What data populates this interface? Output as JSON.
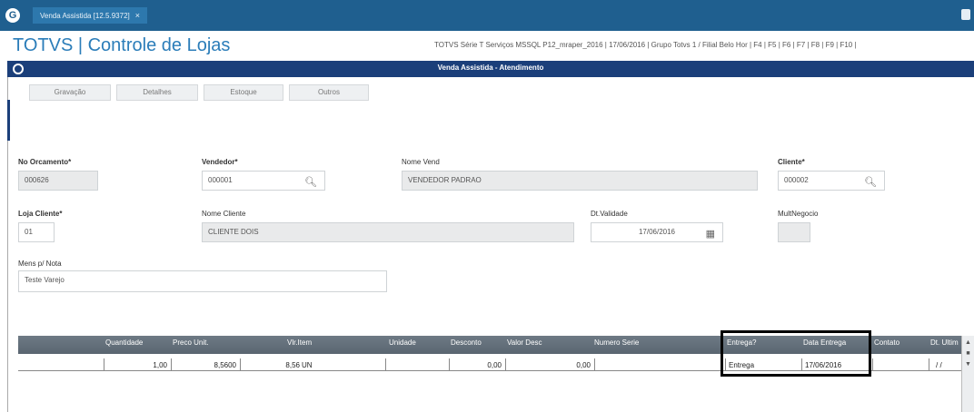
{
  "titlebar": {
    "tab_label": "Venda Assistida [12.5.9372]",
    "tab_close": "×"
  },
  "header": {
    "app_title": "TOTVS | Controle de Lojas",
    "info": "TOTVS Série T Serviços MSSQL P12_mraper_2016  |  17/06/2016  |  Grupo Totvs 1 / Filial Belo Hor  |  F4 | F5 | F6 | F7 | F8 | F9 | F10 |"
  },
  "window": {
    "title": "Venda Assistida - Atendimento"
  },
  "toolbar": {
    "gravacao": "Gravação",
    "detalhes": "Detalhes",
    "estoque": "Estoque",
    "outros": "Outros"
  },
  "form": {
    "num_orcamento": {
      "label": "No Orcamento*",
      "value": "000626"
    },
    "vendedor": {
      "label": "Vendedor*",
      "value": "000001"
    },
    "nome_vend": {
      "label": "Nome Vend",
      "value": "VENDEDOR PADRAO"
    },
    "cliente": {
      "label": "Cliente*",
      "value": "000002"
    },
    "loja_cliente": {
      "label": "Loja Cliente*",
      "value": "01"
    },
    "nome_cliente": {
      "label": "Nome Cliente",
      "value": "CLIENTE DOIS"
    },
    "dt_validade": {
      "label": "Dt.Validade",
      "value": "17/06/2016"
    },
    "multinegocio": {
      "label": "MultNegocio",
      "value": ""
    },
    "mens_nota": {
      "label": "Mens p/ Nota",
      "value": "Teste Varejo"
    }
  },
  "grid": {
    "headers": {
      "quantidade": "Quantidade",
      "preco_unit": "Preco Unit.",
      "vlr_item": "Vlr.Item",
      "unidade": "Unidade",
      "desconto": "Desconto",
      "valor_desc": "Valor Desc",
      "numero_serie": "Numero Serie",
      "entrega": "Entrega?",
      "data_entrega": "Data Entrega",
      "contato": "Contato",
      "dt_ultima": "Dt. Ultim"
    },
    "row": {
      "quantidade": "1,00",
      "preco_unit": "8,5600",
      "vlr_item": "8,56",
      "unidade": "UN",
      "desconto": "0,00",
      "valor_desc": "0,00",
      "numero_serie": "",
      "entrega": "Entrega",
      "data_entrega": "17/06/2016",
      "contato": "",
      "dt_ultima": "/ /"
    }
  },
  "icons": {
    "search": "search-icon",
    "calendar": "calendar-icon",
    "app_logo": "totvs-logo-icon"
  }
}
